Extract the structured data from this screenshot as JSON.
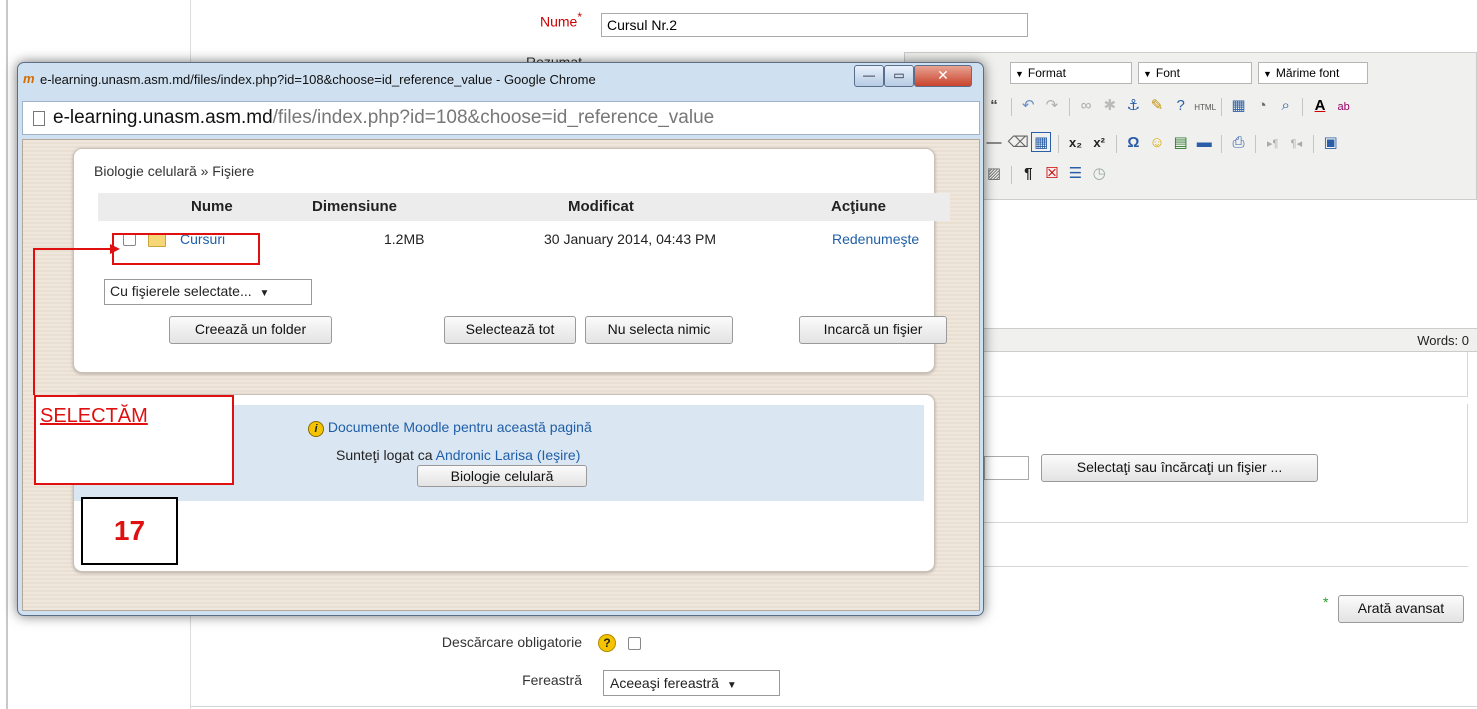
{
  "background_form": {
    "name_label": "Nume",
    "required_mark": "*",
    "name_value": "Cursul Nr.2",
    "summary_label_partial": "Rezumat",
    "toolbar": {
      "format": "Format",
      "font": "Font",
      "font_size": "Mărime font"
    },
    "words_label": "Words: 0",
    "select_file_button": "Selectaţi sau încărcaţi un fişier ...",
    "show_advanced_button": "Arată avansat",
    "force_download_label": "Descărcare obligatorie",
    "window_label": "Fereastră",
    "window_value": "Aceeaşi fereastră"
  },
  "popup": {
    "window_title": "e-learning.unasm.asm.md/files/index.php?id=108&choose=id_reference_value - Google Chrome",
    "logo_text": "m",
    "address_host": "e-learning.unasm.asm.md",
    "address_path": "/files/index.php?id=108&choose=id_reference_value",
    "breadcrumb": "Biologie celulară » Fişiere",
    "columns": [
      "Nume",
      "Dimensiune",
      "Modificat",
      "Acţiune"
    ],
    "rows": [
      {
        "name": "Cursuri",
        "size": "1.2MB",
        "modified": "30 January 2014, 04:43 PM",
        "action": "Redenumeşte"
      }
    ],
    "with_selected": "Cu fişierele selectate...",
    "buttons": {
      "create_folder": "Creează un folder",
      "select_all": "Selectează tot",
      "select_none": "Nu selecta nimic",
      "upload": "Incarcă un fişier"
    },
    "footer": {
      "docs_link": "Documente Moodle pentru această pagină",
      "logged_prefix": "Sunteţi logat ca",
      "user": "Andronic Larisa",
      "logout": "(Ieşire)",
      "course_button": "Biologie celulară"
    }
  },
  "annotation": {
    "label": "SELECTĂM",
    "number": "17",
    "color": "#e01010"
  }
}
